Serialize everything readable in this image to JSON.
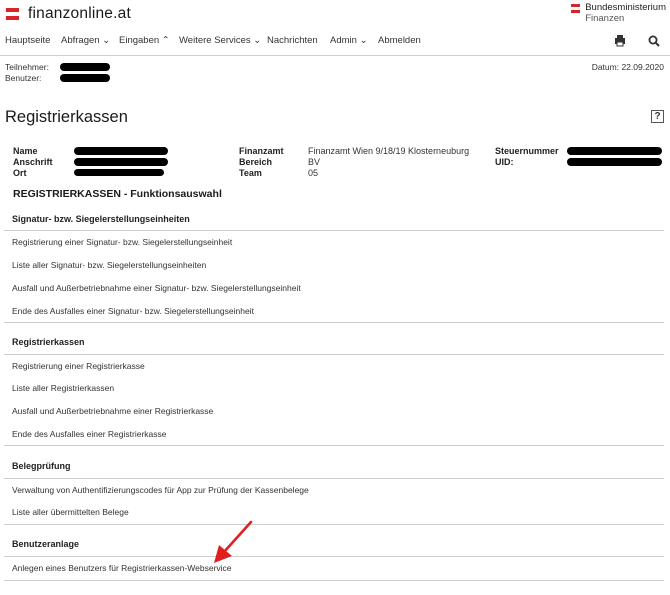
{
  "header": {
    "logo_text": "finanzonline.at",
    "ministry_line1": "Bundesministerium",
    "ministry_line2": "Finanzen"
  },
  "nav": {
    "items": [
      "Hauptseite",
      "Abfragen ⌄",
      "Eingaben ⌃",
      "Weitere Services ⌄",
      "Nachrichten",
      "Admin ⌄",
      "Abmelden"
    ],
    "print_icon": "printer-icon",
    "search_icon": "search-icon"
  },
  "user": {
    "teilnehmer_label": "Teilnehmer:",
    "benutzer_label": "Benutzer:",
    "date": "Datum: 22.09.2020"
  },
  "page": {
    "title": "Registrierkassen",
    "help": "?"
  },
  "info": {
    "col1_labels": [
      "Name",
      "Anschrift",
      "Ort"
    ],
    "col2_labels": [
      "Finanzamt",
      "Bereich",
      "Team"
    ],
    "col2_values": [
      "Finanzamt Wien 9/18/19 Klosterneuburg",
      "BV",
      "05"
    ],
    "col3_labels": [
      "Steuernummer",
      "UID:"
    ]
  },
  "section_title": "REGISTRIERKASSEN - Funktionsauswahl",
  "groups": [
    {
      "title": "Signatur- bzw. Siegelerstellungseinheiten",
      "links": [
        "Registrierung einer Signatur- bzw. Siegelerstellungseinheit",
        "Liste aller Signatur- bzw. Siegelerstellungseinheiten",
        "Ausfall und Außerbetriebnahme einer Signatur- bzw. Siegelerstellungseinheit",
        "Ende des Ausfalles einer Signatur- bzw. Siegelerstellungseinheit"
      ]
    },
    {
      "title": "Registrierkassen",
      "links": [
        "Registrierung einer Registrierkasse",
        "Liste aller Registrierkassen",
        "Ausfall und Außerbetriebnahme einer Registrierkasse",
        "Ende des Ausfalles einer Registrierkasse"
      ]
    },
    {
      "title": "Belegprüfung",
      "links": [
        "Verwaltung von Authentifizierungscodes für App zur Prüfung der Kassenbelege",
        "Liste aller übermittelten Belege"
      ]
    },
    {
      "title": "Benutzeranlage",
      "links": [
        "Anlegen eines Benutzers für Registrierkassen-Webservice"
      ]
    }
  ],
  "colors": {
    "flag_red": "#d8232a",
    "arrow_red": "#e02020",
    "divider": "#cfcfcf"
  }
}
